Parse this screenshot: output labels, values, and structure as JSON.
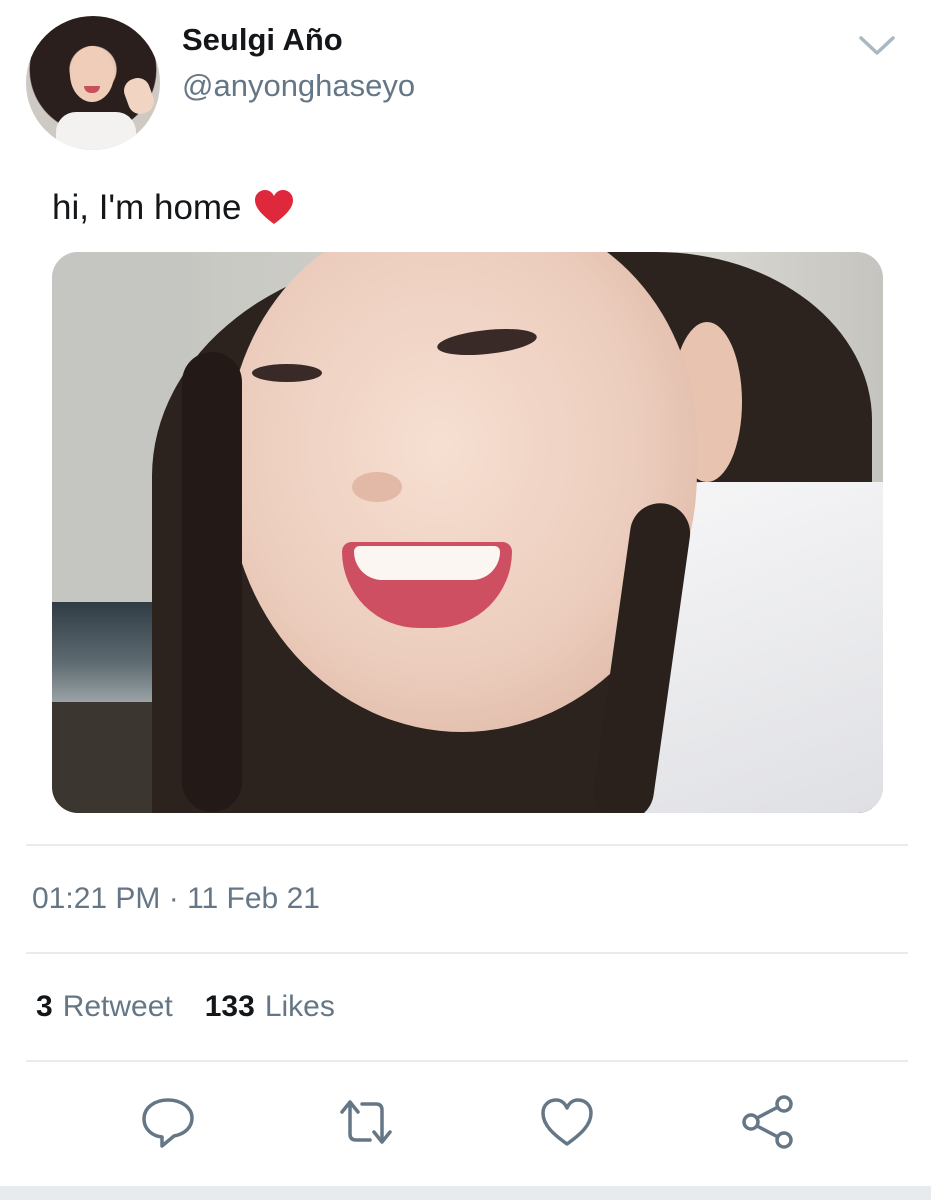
{
  "author": {
    "display_name": "Seulgi Año",
    "handle": "@anyonghaseyo",
    "avatar_icon": "profile-photo"
  },
  "tweet": {
    "text": "hi, I'm home",
    "emoji": "red-heart-emoji",
    "media_description": "selfie photo"
  },
  "meta": {
    "timestamp": "01:21 PM · 11 Feb 21"
  },
  "stats": {
    "retweets_count": "3",
    "retweets_label": "Retweet",
    "likes_count": "133",
    "likes_label": "Likes"
  },
  "actions": [
    {
      "icon": "reply-icon"
    },
    {
      "icon": "retweet-icon"
    },
    {
      "icon": "like-icon"
    },
    {
      "icon": "share-icon"
    }
  ],
  "colors": {
    "primary_text": "#14171a",
    "secondary_text": "#657786",
    "divider": "#e6ecf0",
    "heart": "#e0283c"
  }
}
